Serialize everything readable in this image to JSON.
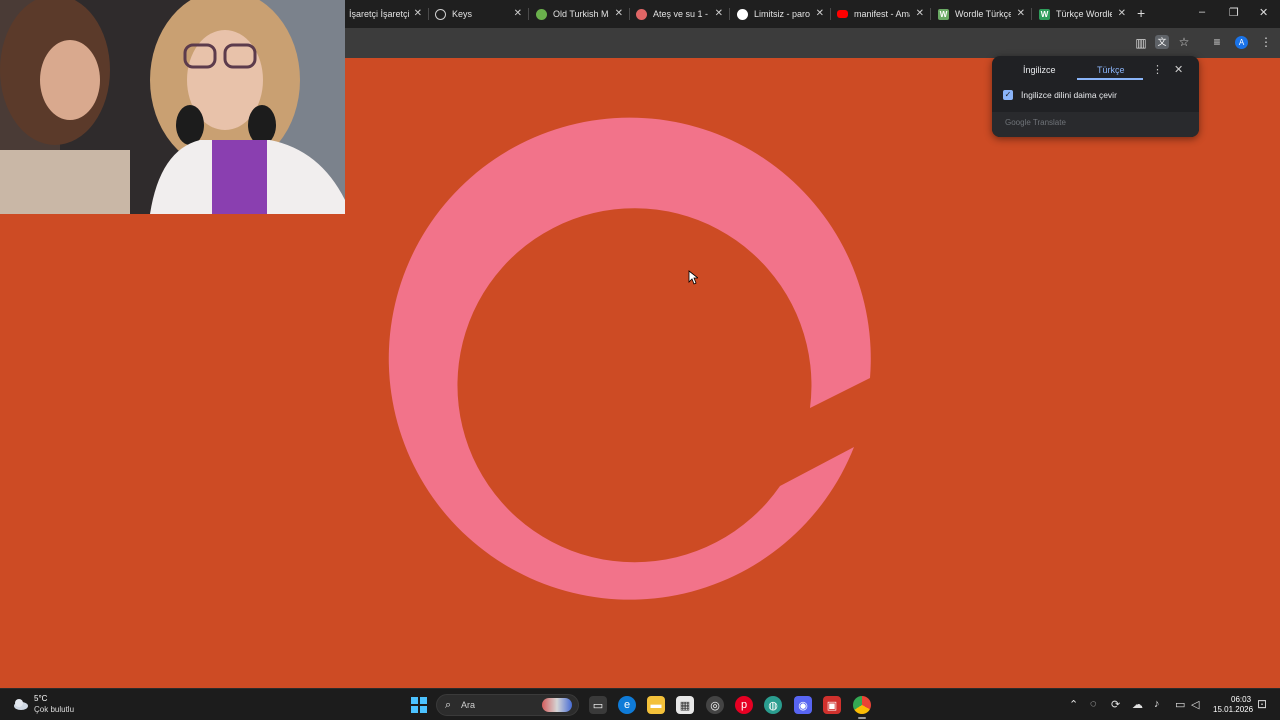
{
  "browser": {
    "tabs": [
      {
        "title": "İşaretçi İşaretçi",
        "favicon": "pointer-icon",
        "color": "#7a7a7a"
      },
      {
        "title": "Keys",
        "favicon": "globe-icon",
        "color": "#9aa0a6"
      },
      {
        "title": "Old Turkish Ma",
        "favicon": "map-icon",
        "color": "#6ab04c"
      },
      {
        "title": "Ateş ve su 1 - (",
        "favicon": "game-icon",
        "color": "#e06666"
      },
      {
        "title": "Limitsiz - parol",
        "favicon": "lock-icon",
        "color": "#ffffff"
      },
      {
        "title": "manifest - Ama",
        "favicon": "youtube-icon",
        "color": "#ff0000"
      },
      {
        "title": "Wordle Türkçe",
        "favicon": "w-icon",
        "color": "#6aaa64",
        "letter": "W"
      },
      {
        "title": "Türkçe Wordle",
        "favicon": "w-icon",
        "color": "#2e9e5b",
        "letter": "W"
      }
    ],
    "new_tab": "+",
    "window": {
      "minimize": "–",
      "restore": "❐",
      "close": "✕"
    },
    "profile_initial": "A"
  },
  "translate_popup": {
    "source_lang": "İngilizce",
    "target_lang": "Türkçe",
    "always_translate_label": "İngilizce dilini daima çevir",
    "always_translate_checked": true,
    "brand": "Google Translate"
  },
  "page": {
    "background": "#cd4b24",
    "ring_color": "#f2738a"
  },
  "taskbar": {
    "weather": {
      "temp": "5°C",
      "desc": "Çok bulutlu"
    },
    "search_placeholder": "Ara",
    "clock": {
      "time": "06:03",
      "date": "15.01.2026"
    }
  }
}
